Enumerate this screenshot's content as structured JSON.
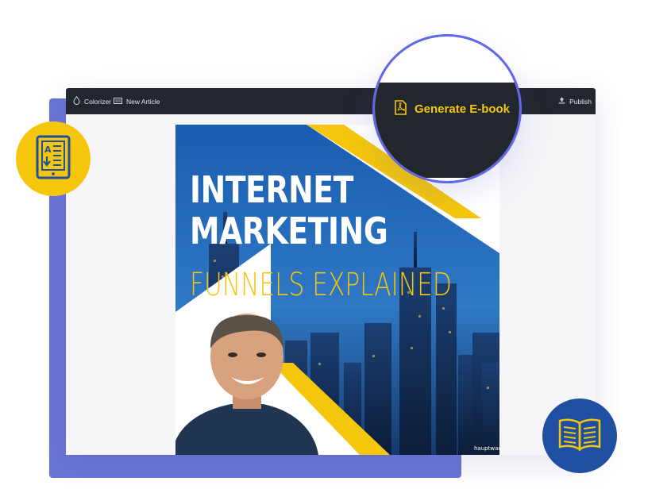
{
  "toolbar": {
    "colorizer_label": "Colorizer",
    "new_article_label": "New Article",
    "publish_label": "Publish"
  },
  "magnifier": {
    "generate_label": "Generate E-book"
  },
  "cover": {
    "title_line1": "INTERNET",
    "title_line2": "MARKETING",
    "subtitle": "FUNNELS EXPLAINED",
    "watermark": "hauptwache"
  },
  "badges": {
    "left_icon": "ebook-reader-icon",
    "right_icon": "open-book-icon"
  },
  "colors": {
    "accent_yellow": "#f5c60b",
    "toolbar_dark": "#22262d",
    "panel_purple": "#6b75d6",
    "badge_blue": "#1f4fa0",
    "ring_blue": "#6068e8"
  }
}
